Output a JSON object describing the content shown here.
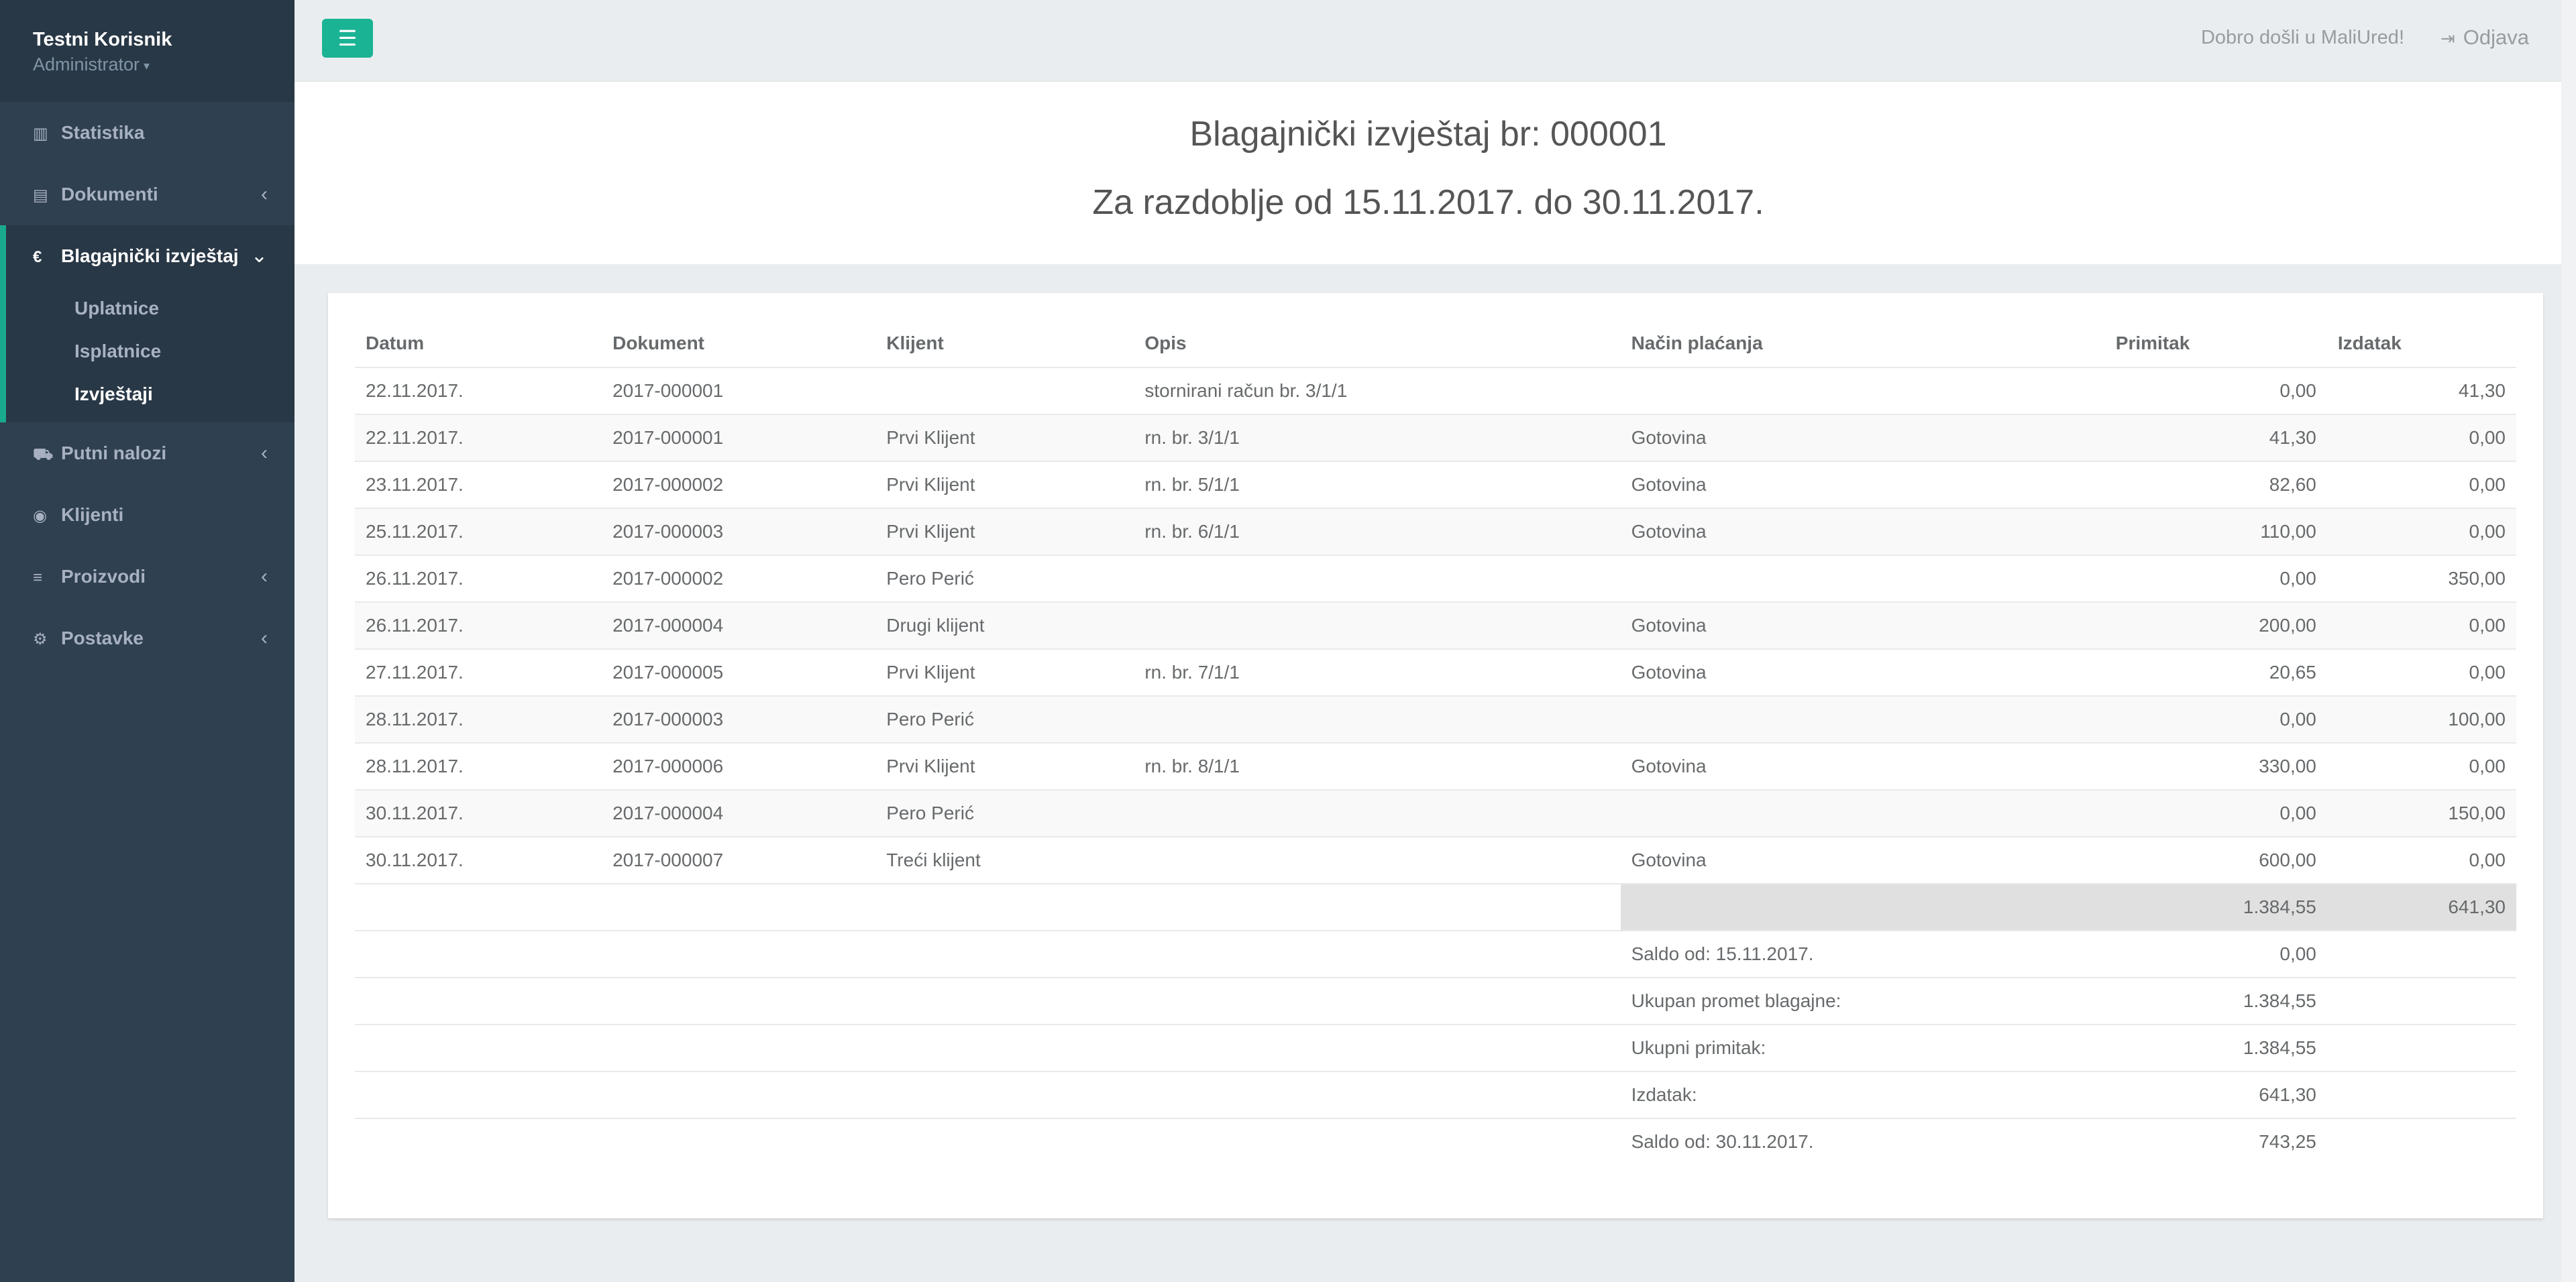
{
  "user": {
    "name": "Testni Korisnik",
    "role": "Administrator"
  },
  "sidebar": {
    "items": [
      {
        "label": "Statistika",
        "icon": "bar-chart-icon"
      },
      {
        "label": "Dokumenti",
        "icon": "document-icon"
      },
      {
        "label": "Blagajnički izvještaj",
        "icon": "euro-icon"
      },
      {
        "label": "Putni nalozi",
        "icon": "car-icon"
      },
      {
        "label": "Klijenti",
        "icon": "user-circle-icon"
      },
      {
        "label": "Proizvodi",
        "icon": "list-icon"
      },
      {
        "label": "Postavke",
        "icon": "gear-icon"
      }
    ],
    "subitems": [
      "Uplatnice",
      "Isplatnice",
      "Izvještaji"
    ]
  },
  "topbar": {
    "welcome": "Dobro došli u MaliUred!",
    "logout": "Odjava"
  },
  "report": {
    "title": "Blagajnički izvještaj br: 000001",
    "period": "Za razdoblje od 15.11.2017. do 30.11.2017."
  },
  "table": {
    "headers": [
      "Datum",
      "Dokument",
      "Klijent",
      "Opis",
      "Način plaćanja",
      "Primitak",
      "Izdatak"
    ],
    "rows": [
      [
        "22.11.2017.",
        "2017-000001",
        "",
        "stornirani račun br. 3/1/1",
        "",
        "0,00",
        "41,30"
      ],
      [
        "22.11.2017.",
        "2017-000001",
        "Prvi Klijent",
        "rn. br. 3/1/1",
        "Gotovina",
        "41,30",
        "0,00"
      ],
      [
        "23.11.2017.",
        "2017-000002",
        "Prvi Klijent",
        "rn. br. 5/1/1",
        "Gotovina",
        "82,60",
        "0,00"
      ],
      [
        "25.11.2017.",
        "2017-000003",
        "Prvi Klijent",
        "rn. br. 6/1/1",
        "Gotovina",
        "110,00",
        "0,00"
      ],
      [
        "26.11.2017.",
        "2017-000002",
        "Pero Perić",
        "",
        "",
        "0,00",
        "350,00"
      ],
      [
        "26.11.2017.",
        "2017-000004",
        "Drugi klijent",
        "",
        "Gotovina",
        "200,00",
        "0,00"
      ],
      [
        "27.11.2017.",
        "2017-000005",
        "Prvi Klijent",
        "rn. br. 7/1/1",
        "Gotovina",
        "20,65",
        "0,00"
      ],
      [
        "28.11.2017.",
        "2017-000003",
        "Pero Perić",
        "",
        "",
        "0,00",
        "100,00"
      ],
      [
        "28.11.2017.",
        "2017-000006",
        "Prvi Klijent",
        "rn. br. 8/1/1",
        "Gotovina",
        "330,00",
        "0,00"
      ],
      [
        "30.11.2017.",
        "2017-000004",
        "Pero Perić",
        "",
        "",
        "0,00",
        "150,00"
      ],
      [
        "30.11.2017.",
        "2017-000007",
        "Treći klijent",
        "",
        "Gotovina",
        "600,00",
        "0,00"
      ]
    ],
    "totals": {
      "primitak": "1.384,55",
      "izdatak": "641,30"
    },
    "summary": [
      {
        "label": "Saldo od: 15.11.2017.",
        "value": "0,00"
      },
      {
        "label": "Ukupan promet blagajne:",
        "value": "1.384,55"
      },
      {
        "label": "Ukupni primitak:",
        "value": "1.384,55"
      },
      {
        "label": "Izdatak:",
        "value": "641,30"
      },
      {
        "label": "Saldo od: 30.11.2017.",
        "value": "743,25"
      }
    ]
  },
  "colors": {
    "sidebar": "#2f4050",
    "accent": "#1ab394",
    "background": "#e9edef"
  }
}
